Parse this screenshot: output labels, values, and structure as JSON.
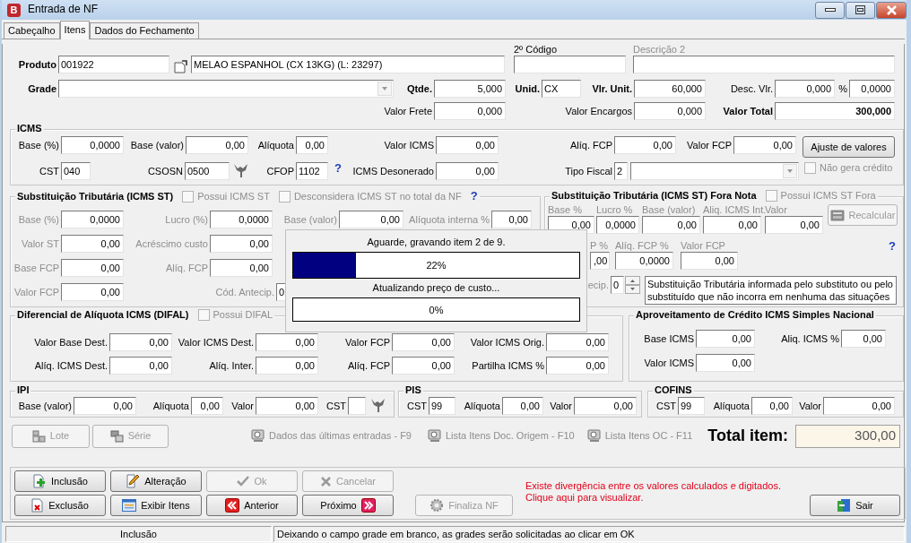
{
  "window": {
    "icon_letter": "B",
    "title": "Entrada de NF"
  },
  "tabs": [
    {
      "label": "Cabeçalho",
      "selected": false
    },
    {
      "label": "Itens",
      "selected": true
    },
    {
      "label": "Dados do Fechamento",
      "selected": false
    }
  ],
  "header": {
    "items": [
      {
        "kind": "code",
        "label": "Produto",
        "emphasis": true,
        "value": "001922"
      },
      {
        "kind": "lookup"
      },
      {
        "kind": "code",
        "value": "MELAO ESPANHOL (CX 13KG) (L: 23297)"
      },
      {
        "kind": "stacked",
        "label": "2º Código"
      },
      {
        "kind": "stacked",
        "label": "Descrição 2",
        "disabled": true
      },
      {
        "kind": "combo",
        "label": "Grade",
        "emphasis": true
      },
      {
        "kind": "field",
        "label": "Qtde.",
        "emphasis": true,
        "value": "5,000"
      },
      {
        "kind": "code",
        "label": "Unid.",
        "emphasis": true,
        "value": "CX"
      },
      {
        "kind": "field",
        "label": "Vlr. Unit.",
        "emphasis": true,
        "value": "60,000"
      },
      {
        "kind": "field",
        "label": "Desc. Vlr.",
        "value": "0,000"
      },
      {
        "kind": "field",
        "label": "%",
        "value": "0,0000"
      },
      {
        "kind": "field",
        "label": "Valor Frete",
        "value": "0,000"
      },
      {
        "kind": "field",
        "label": "Valor Encargos",
        "value": "0,000"
      },
      {
        "kind": "field",
        "label": "Valor Total",
        "emphasis": true,
        "value_bold": true,
        "value": "300,000"
      }
    ]
  },
  "group_lines": [
    [
      {
        "title": "ICMS",
        "items": [
          {
            "kind": "field",
            "label": "Base (%)",
            "value": "0,0000"
          },
          {
            "kind": "field",
            "label": "Base (valor)",
            "value": "0,00"
          },
          {
            "kind": "field",
            "label": "Alíquota",
            "value": "0,00"
          },
          {
            "kind": "field",
            "label": "Valor ICMS",
            "value": "0,00"
          },
          {
            "kind": "field",
            "label": "Alíq. FCP",
            "value": "0,00"
          },
          {
            "kind": "field",
            "label": "Valor FCP",
            "value": "0,00"
          },
          {
            "kind": "button",
            "label": "Ajuste de valores"
          },
          {
            "kind": "code",
            "label": "CST",
            "value": "040"
          },
          {
            "kind": "code",
            "label": "CSOSN",
            "value": "0500"
          },
          {
            "kind": "filter"
          },
          {
            "kind": "code",
            "label": "CFOP",
            "value": "1102"
          },
          {
            "kind": "help",
            "text": "?"
          },
          {
            "kind": "field",
            "label": "ICMS Desonerado",
            "value": "0,00"
          },
          {
            "kind": "code",
            "label": "Tipo Fiscal",
            "value": "2"
          },
          {
            "kind": "combo"
          },
          {
            "kind": "check",
            "label": "Não gera crédito",
            "checked": false,
            "disabled": true
          }
        ]
      }
    ],
    [
      {
        "title": "Substituição Tributária (ICMS ST)",
        "disabled": true,
        "legend_items": [
          {
            "kind": "check",
            "label": "Possui ICMS ST",
            "checked": false,
            "disabled": true
          },
          {
            "kind": "check",
            "label": "Desconsidera ICMS ST no total da NF",
            "checked": false,
            "disabled": true
          },
          {
            "kind": "help",
            "text": "?"
          }
        ],
        "items": [
          {
            "kind": "field",
            "label": "Base (%)",
            "value": "0,0000"
          },
          {
            "kind": "field",
            "label": "Lucro (%)",
            "value": "0,0000"
          },
          {
            "kind": "field",
            "label": "Base (valor)",
            "value": "0,00"
          },
          {
            "kind": "field",
            "label": "Alíquota interna %",
            "value": "0,00"
          },
          {
            "kind": "field",
            "label": "Valor ST",
            "value": "0,00"
          },
          {
            "kind": "field",
            "label": "Acréscimo custo",
            "value": "0,00"
          },
          {
            "kind": "field",
            "label": "Base FCP",
            "value": "0,00"
          },
          {
            "kind": "field",
            "label": "Alíq. FCP",
            "value": "0,00"
          },
          {
            "kind": "field",
            "label": "Valor FCP",
            "value": "0,00"
          },
          {
            "kind": "code",
            "label": "Cód. Antecip.",
            "value": "0"
          }
        ]
      },
      {
        "title": "Substituição Tributária (ICMS ST) Fora Nota",
        "disabled": true,
        "legend_items": [
          {
            "kind": "check",
            "label": "Possui ICMS ST Fora",
            "checked": false,
            "disabled": true
          }
        ],
        "items": [
          {
            "kind": "stacked",
            "label": "Base %",
            "value": "0,00"
          },
          {
            "kind": "stacked",
            "label": "Lucro %",
            "value": "0,0000"
          },
          {
            "kind": "stacked",
            "label": "Base (valor)",
            "value": "0,00"
          },
          {
            "kind": "stacked",
            "label": "Aliq. ICMS Int.",
            "value": "0,00"
          },
          {
            "kind": "stacked",
            "label": "Valor",
            "value": "0,00"
          },
          {
            "kind": "recalc",
            "label": "Recalcular",
            "disabled": true
          },
          {
            "kind": "stacked",
            "label": "P %",
            "value": ",00"
          },
          {
            "kind": "stacked",
            "label": "Alíq. FCP %",
            "value": "0,0000"
          },
          {
            "kind": "stacked",
            "label": "Valor FCP",
            "value": "0,00"
          },
          {
            "kind": "help",
            "text": "?"
          },
          {
            "kind": "spin",
            "label": "ecip.",
            "value": "0"
          },
          {
            "kind": "memo",
            "value": "Substituição Tributária informada pelo substituto ou pelo substituído que não incorra em nenhuma das situações"
          }
        ]
      }
    ],
    [
      {
        "title": "Diferencial de Alíquota ICMS (DIFAL)",
        "legend_items": [
          {
            "kind": "check",
            "label": "Possui DIFAL",
            "checked": false,
            "disabled": true
          }
        ],
        "items": [
          {
            "kind": "field",
            "label": "Valor Base Dest.",
            "value": "0,00"
          },
          {
            "kind": "field",
            "label": "Valor ICMS Dest.",
            "value": "0,00"
          },
          {
            "kind": "field",
            "label": "Valor FCP",
            "value": "0,00"
          },
          {
            "kind": "field",
            "label": "Valor ICMS Orig.",
            "value": "0,00"
          },
          {
            "kind": "field",
            "label": "Alíq. ICMS Dest.",
            "value": "0,00"
          },
          {
            "kind": "field",
            "label": "Alíq. Inter.",
            "value": "0,00"
          },
          {
            "kind": "field",
            "label": "Alíq. FCP",
            "value": "0,00"
          },
          {
            "kind": "field",
            "label": "Partilha ICMS %",
            "value": "0,00"
          }
        ]
      },
      {
        "title": "Aproveitamento de Crédito ICMS Simples Nacional",
        "items": [
          {
            "kind": "field",
            "label": "Base ICMS",
            "value": "0,00"
          },
          {
            "kind": "field",
            "label": "Aliq. ICMS %",
            "value": "0,00"
          },
          {
            "kind": "field",
            "label": "Valor ICMS",
            "value": "0,00"
          }
        ]
      }
    ],
    [
      {
        "title": "IPI",
        "items": [
          {
            "kind": "field",
            "label": "Base (valor)",
            "value": "0,00"
          },
          {
            "kind": "field",
            "label": "Alíquota",
            "value": "0,00"
          },
          {
            "kind": "field",
            "label": "Valor",
            "value": "0,00"
          },
          {
            "kind": "code",
            "label": "CST"
          },
          {
            "kind": "filter"
          }
        ]
      },
      {
        "title": "PIS",
        "items": [
          {
            "kind": "code",
            "label": "CST",
            "value": "99"
          },
          {
            "kind": "field",
            "label": "Alíquota",
            "value": "0,00"
          },
          {
            "kind": "field",
            "label": "Valor",
            "value": "0,00"
          }
        ]
      },
      {
        "title": "COFINS",
        "items": [
          {
            "kind": "code",
            "label": "CST",
            "value": "99"
          },
          {
            "kind": "field",
            "label": "Alíquota",
            "value": "0,00"
          },
          {
            "kind": "field",
            "label": "Valor",
            "value": "0,00"
          }
        ]
      }
    ]
  ],
  "toolbar": {
    "buttons": [
      {
        "kind": "lot",
        "label": "Lote",
        "disabled": true
      },
      {
        "kind": "serial",
        "label": "Série",
        "disabled": true
      }
    ],
    "links": [
      {
        "label": "Dados das últimas entradas - F9",
        "disabled": true
      },
      {
        "label": "Lista Itens Doc. Origem - F10",
        "disabled": true
      },
      {
        "label": "Lista Itens OC - F11",
        "disabled": true
      }
    ],
    "total_label": "Total item:",
    "total_value": "300,00"
  },
  "actions": {
    "buttons": [
      {
        "kind": "add",
        "label": "Inclusão",
        "disabled": false
      },
      {
        "kind": "edit",
        "label": "Alteração",
        "disabled": false
      },
      {
        "kind": "confirm",
        "label": "Ok",
        "disabled": true
      },
      {
        "kind": "cancel",
        "label": "Cancelar",
        "disabled": true
      },
      {
        "kind": "delete",
        "label": "Exclusão",
        "disabled": false
      },
      {
        "kind": "list",
        "label": "Exibir Itens",
        "disabled": false
      },
      {
        "kind": "prev",
        "label": "Anterior",
        "disabled": false
      },
      {
        "kind": "next",
        "label": "Próximo",
        "disabled": false
      }
    ],
    "finalize": {
      "kind": "finalize",
      "label": "Finaliza NF",
      "disabled": true
    },
    "message": [
      "Existe divergência entre os valores calculados e digitados.",
      "Clique aqui para visualizar."
    ],
    "exit": {
      "kind": "exit",
      "label": "Sair",
      "disabled": false
    }
  },
  "status_bar": [
    "Inclusão",
    "Deixando o campo grade em branco, as grades serão solicitadas ao clicar em OK"
  ],
  "progress_dialog": {
    "steps": [
      {
        "text": "Aguarde, gravando item 2 de 9.",
        "level": 0.22,
        "reading": "22%"
      },
      {
        "text": "Atualizando preço de custo...",
        "level": 0,
        "reading": "0%"
      }
    ]
  }
}
